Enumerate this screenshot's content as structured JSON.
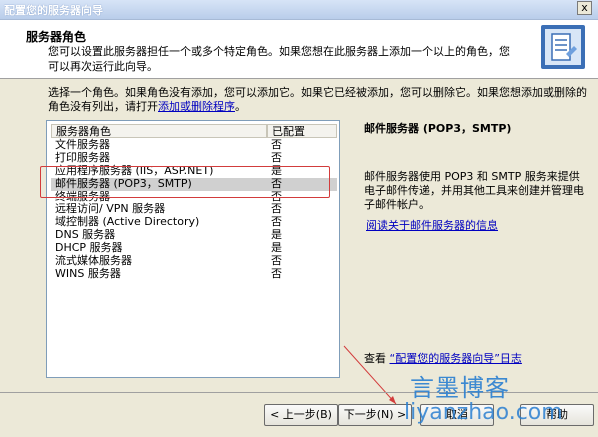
{
  "window": {
    "title": "配置您的服务器向导",
    "close_glyph": "x"
  },
  "header": {
    "title": "服务器角色",
    "description": "您可以设置此服务器担任一个或多个特定角色。如果您想在此服务器上添加一个以上的角色，您可以再次运行此向导。"
  },
  "intro": {
    "text": "选择一个角色。如果角色没有添加，您可以添加它。如果它已经被添加，您可以删除它。如果您想添加或删除的角色没有列出，请打开",
    "link": "添加或删除程序",
    "suffix": "。"
  },
  "list": {
    "columns": {
      "role": "服务器角色",
      "configured": "已配置"
    },
    "rows": [
      {
        "role": "文件服务器",
        "configured": "否"
      },
      {
        "role": "打印服务器",
        "configured": "否"
      },
      {
        "role": "应用程序服务器 (IIS，ASP.NET)",
        "configured": "是"
      },
      {
        "role": "邮件服务器 (POP3，SMTP)",
        "configured": "否"
      },
      {
        "role": "终端服务器",
        "configured": "否"
      },
      {
        "role": "远程访问/ VPN 服务器",
        "configured": "否"
      },
      {
        "role": "域控制器 (Active Directory)",
        "configured": "否"
      },
      {
        "role": "DNS 服务器",
        "configured": "是"
      },
      {
        "role": "DHCP 服务器",
        "configured": "是"
      },
      {
        "role": "流式媒体服务器",
        "configured": "否"
      },
      {
        "role": "WINS 服务器",
        "configured": "否"
      }
    ],
    "selected_index": 3
  },
  "details": {
    "title": "邮件服务器 (POP3，SMTP)",
    "description": "邮件服务器使用 POP3 和 SMTP 服务来提供电子邮件传递，并用其他工具来创建并管理电子邮件帐户。",
    "link": "阅读关于邮件服务器的信息"
  },
  "log": {
    "prefix": "查看",
    "link": "“配置您的服务器向导”日志"
  },
  "buttons": {
    "back": "< 上一步(B)",
    "next": "下一步(N) >",
    "cancel": "取消",
    "help": "帮助"
  },
  "watermark": {
    "line1": "言墨博客",
    "line2": "liyanzhao.com"
  },
  "colors": {
    "highlight": "#d23c3c",
    "link": "#0000c0",
    "watermark": "#2a7fd1"
  }
}
